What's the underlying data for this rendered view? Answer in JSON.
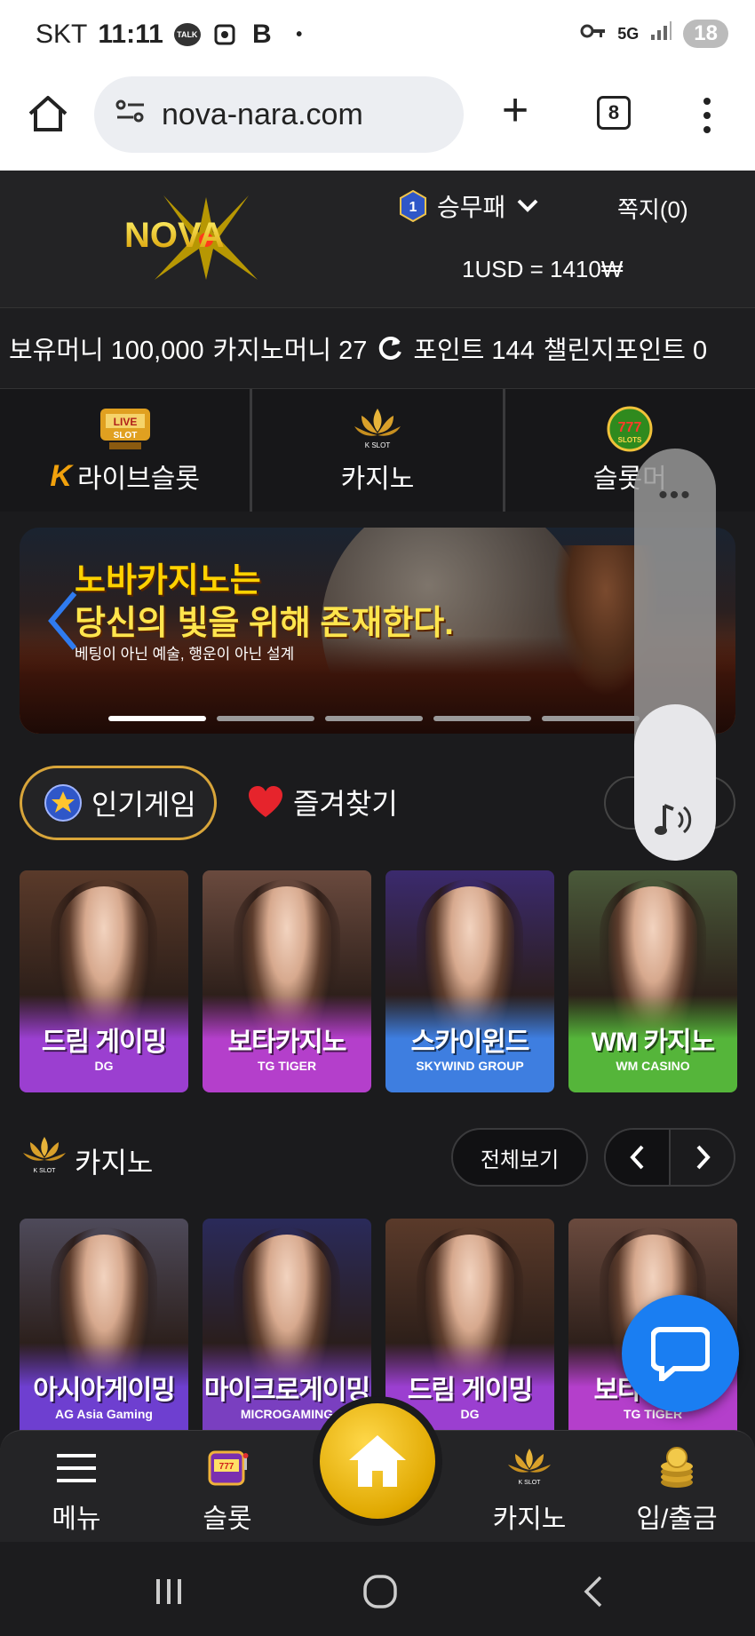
{
  "status_bar": {
    "carrier": "SKT",
    "time": "11:11",
    "network": "5G",
    "battery": "18",
    "icons": [
      "kakaotalk-icon",
      "screenshot-icon",
      "b-app-icon",
      "key-icon",
      "signal-icon"
    ]
  },
  "browser": {
    "url": "nova-nara.com",
    "tab_count": "8"
  },
  "header": {
    "logo_text": "NOVA",
    "level_badge": "1",
    "username": "승무패",
    "messages": "쪽지(0)",
    "exchange_rate": "1USD = 1410₩"
  },
  "balance": {
    "money": "보유머니 100,000",
    "casino_money": "카지노머니 27",
    "points": "포인트 144",
    "challenge_points": "챌린지포인트 0"
  },
  "categories": [
    {
      "label": "라이브슬롯",
      "icon_text": "LIVE SLOT",
      "icon": "live-slot-icon"
    },
    {
      "label": "카지노",
      "icon_text": "K SLOT",
      "icon": "casino-lotus-icon"
    },
    {
      "label": "슬롯머",
      "icon_text": "777 SLOTS",
      "icon": "slots-777-icon"
    }
  ],
  "banner": {
    "title_line1": "노바카지노는",
    "title_line2": "당신의 빛을 위해 존재한다.",
    "subtitle": "베팅이 아닌 예술, 행운이 아닌 설계",
    "slide_count": 5,
    "active_slide": 1
  },
  "volume": {
    "level": 0.38
  },
  "game_tabs": {
    "popular": "인기게임",
    "favorites": "즐겨찾기"
  },
  "popular_games": [
    {
      "name": "드림 게이밍",
      "brand": "DG",
      "bg_top": "#5a3a2a",
      "bg_bottom": "#9b3fd0"
    },
    {
      "name": "보타카지노",
      "brand": "TG TIGER",
      "bg_top": "#6a4a3e",
      "bg_bottom": "#b43fcb"
    },
    {
      "name": "스카이윈드",
      "brand": "SKYWIND GROUP",
      "bg_top": "#3b2a6e",
      "bg_bottom": "#3e7ee0"
    },
    {
      "name": "WM 카지노",
      "brand": "WM CASINO",
      "bg_top": "#4a5a3a",
      "bg_bottom": "#55b53a"
    }
  ],
  "casino_section": {
    "title": "카지노",
    "view_all": "전체보기"
  },
  "casino_games": [
    {
      "name": "아시아게이밍",
      "brand": "AG Asia Gaming",
      "bg_top": "#4e4a5a",
      "bg_bottom": "#6e3fd0"
    },
    {
      "name": "마이크로게이밍",
      "brand": "MICROGAMING",
      "bg_top": "#2a2a5a",
      "bg_bottom": "#7a3fc0"
    },
    {
      "name": "드림 게이밍",
      "brand": "DG",
      "bg_top": "#5a3a2a",
      "bg_bottom": "#9b3fd0"
    },
    {
      "name": "보타카지노",
      "brand": "TG TIGER",
      "bg_top": "#6a4a3e",
      "bg_bottom": "#b43fcb"
    }
  ],
  "bottom_nav": [
    {
      "label": "메뉴",
      "icon": "hamburger-menu-icon"
    },
    {
      "label": "슬롯",
      "icon": "slot-machine-icon"
    },
    {
      "label": "카지노",
      "icon": "casino-lotus-icon"
    },
    {
      "label": "입/출금",
      "icon": "coins-icon"
    }
  ],
  "colors": {
    "background": "#1b1b1d",
    "accent_gold": "#d8a53a",
    "chat_blue": "#1a7ef2",
    "banner_yellow": "#ffd200"
  }
}
